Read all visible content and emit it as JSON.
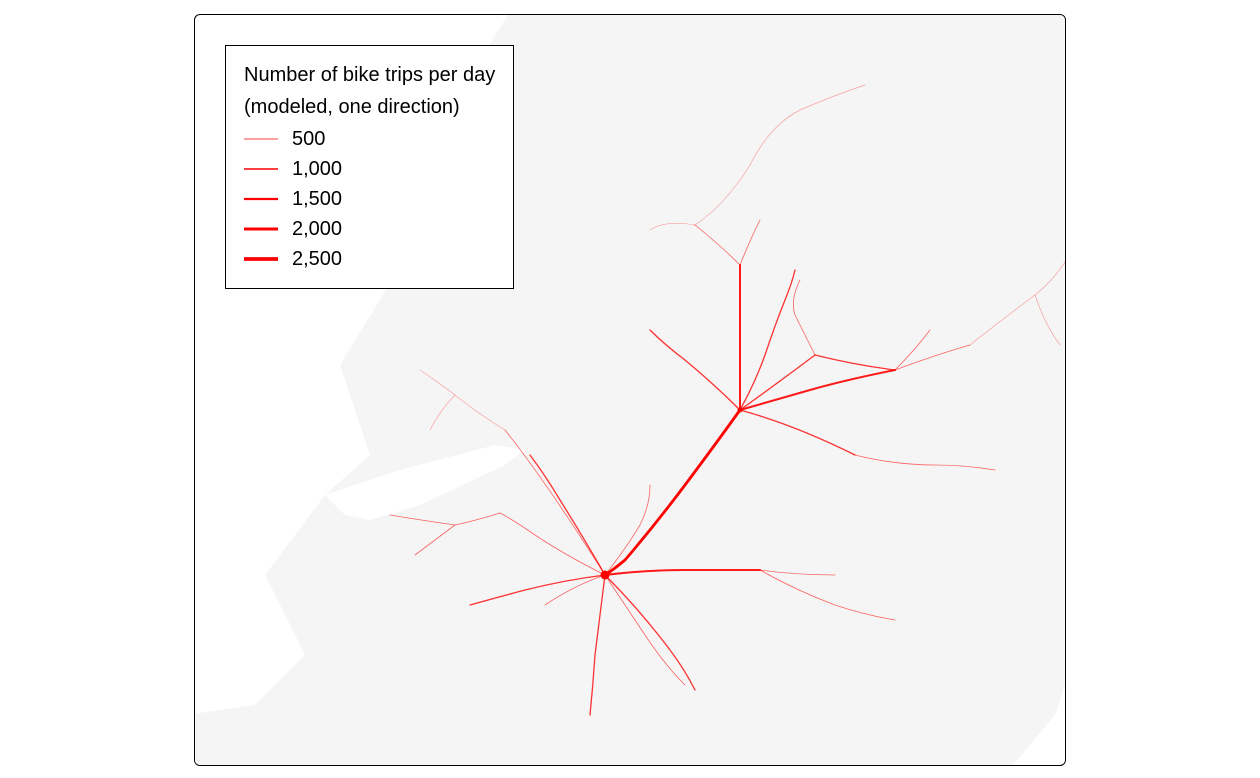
{
  "legend": {
    "title_line1": "Number of bike trips per day",
    "title_line2": "(modeled, one direction)",
    "items": [
      {
        "label": "500",
        "width": 0.7
      },
      {
        "label": "1,000",
        "width": 1.4
      },
      {
        "label": "1,500",
        "width": 2.2
      },
      {
        "label": "2,000",
        "width": 3.0
      },
      {
        "label": "2,500",
        "width": 3.8
      }
    ]
  },
  "colors": {
    "land": "#f5f5f5",
    "route": "#ff0000",
    "frame": "#000000"
  },
  "chart_data": {
    "type": "map-flow",
    "description": "Map panel showing modeled bicycle trip flows over a road network. Line width encodes the number of daily bike trips (one direction). Flows converge on a central hub slightly below centre, with a secondary cluster to the upper right. Surrounding light-grey polygon is the land/study area; white areas are outside it (coast/estuary to the west).",
    "legend_scale": [
      {
        "value": 500,
        "stroke_width_px": 0.7
      },
      {
        "value": 1000,
        "stroke_width_px": 1.4
      },
      {
        "value": 1500,
        "stroke_width_px": 2.2
      },
      {
        "value": 2000,
        "stroke_width_px": 3.0
      },
      {
        "value": 2500,
        "stroke_width_px": 3.8
      }
    ],
    "hub_point": {
      "x_frac": 0.47,
      "y_frac": 0.745,
      "approx_peak_trips": 2500
    },
    "secondary_cluster": {
      "x_frac": 0.63,
      "y_frac": 0.53,
      "approx_peak_trips": 1500
    },
    "route_segments": [
      {
        "from": [
          0.47,
          0.745
        ],
        "to": [
          0.63,
          0.53
        ],
        "trips": 1800
      },
      {
        "from": [
          0.63,
          0.53
        ],
        "to": [
          0.62,
          0.41
        ],
        "trips": 1000
      },
      {
        "from": [
          0.62,
          0.41
        ],
        "to": [
          0.6,
          0.33
        ],
        "trips": 600
      },
      {
        "from": [
          0.63,
          0.53
        ],
        "to": [
          0.72,
          0.49
        ],
        "trips": 1200
      },
      {
        "from": [
          0.72,
          0.49
        ],
        "to": [
          0.79,
          0.46
        ],
        "trips": 700
      },
      {
        "from": [
          0.79,
          0.46
        ],
        "to": [
          0.93,
          0.43
        ],
        "trips": 350
      },
      {
        "from": [
          0.63,
          0.53
        ],
        "to": [
          0.76,
          0.59
        ],
        "trips": 600
      },
      {
        "from": [
          0.47,
          0.745
        ],
        "to": [
          0.42,
          0.59
        ],
        "trips": 1200
      },
      {
        "from": [
          0.42,
          0.59
        ],
        "to": [
          0.38,
          0.53
        ],
        "trips": 700
      },
      {
        "from": [
          0.47,
          0.745
        ],
        "to": [
          0.53,
          0.6
        ],
        "trips": 900
      },
      {
        "from": [
          0.47,
          0.745
        ],
        "to": [
          0.58,
          0.65
        ],
        "trips": 900
      },
      {
        "from": [
          0.47,
          0.745
        ],
        "to": [
          0.65,
          0.74
        ],
        "trips": 1200
      },
      {
        "from": [
          0.65,
          0.74
        ],
        "to": [
          0.76,
          0.74
        ],
        "trips": 500
      },
      {
        "from": [
          0.47,
          0.745
        ],
        "to": [
          0.46,
          0.87
        ],
        "trips": 700
      },
      {
        "from": [
          0.47,
          0.745
        ],
        "to": [
          0.52,
          0.88
        ],
        "trips": 600
      },
      {
        "from": [
          0.47,
          0.745
        ],
        "to": [
          0.4,
          0.82
        ],
        "trips": 500
      },
      {
        "from": [
          0.47,
          0.745
        ],
        "to": [
          0.36,
          0.7
        ],
        "trips": 700
      },
      {
        "from": [
          0.36,
          0.7
        ],
        "to": [
          0.29,
          0.68
        ],
        "trips": 400
      },
      {
        "from": [
          0.47,
          0.745
        ],
        "to": [
          0.56,
          0.82
        ],
        "trips": 500
      },
      {
        "from": [
          0.53,
          0.6
        ],
        "to": [
          0.63,
          0.53
        ],
        "trips": 700
      },
      {
        "from": [
          0.72,
          0.49
        ],
        "to": [
          0.7,
          0.4
        ],
        "trips": 400
      },
      {
        "from": [
          0.62,
          0.41
        ],
        "to": [
          0.56,
          0.37
        ],
        "trips": 400
      },
      {
        "from": [
          0.93,
          0.43
        ],
        "to": [
          0.97,
          0.37
        ],
        "trips": 200
      },
      {
        "from": [
          0.76,
          0.59
        ],
        "to": [
          0.87,
          0.6
        ],
        "trips": 300
      },
      {
        "from": [
          0.6,
          0.33
        ],
        "to": [
          0.64,
          0.2
        ],
        "trips": 300
      },
      {
        "from": [
          0.64,
          0.2
        ],
        "to": [
          0.73,
          0.11
        ],
        "trips": 200
      },
      {
        "from": [
          0.38,
          0.53
        ],
        "to": [
          0.32,
          0.5
        ],
        "trips": 300
      },
      {
        "from": [
          0.29,
          0.68
        ],
        "to": [
          0.2,
          0.64
        ],
        "trips": 200
      },
      {
        "from": [
          0.65,
          0.74
        ],
        "to": [
          0.68,
          0.82
        ],
        "trips": 300
      }
    ]
  }
}
